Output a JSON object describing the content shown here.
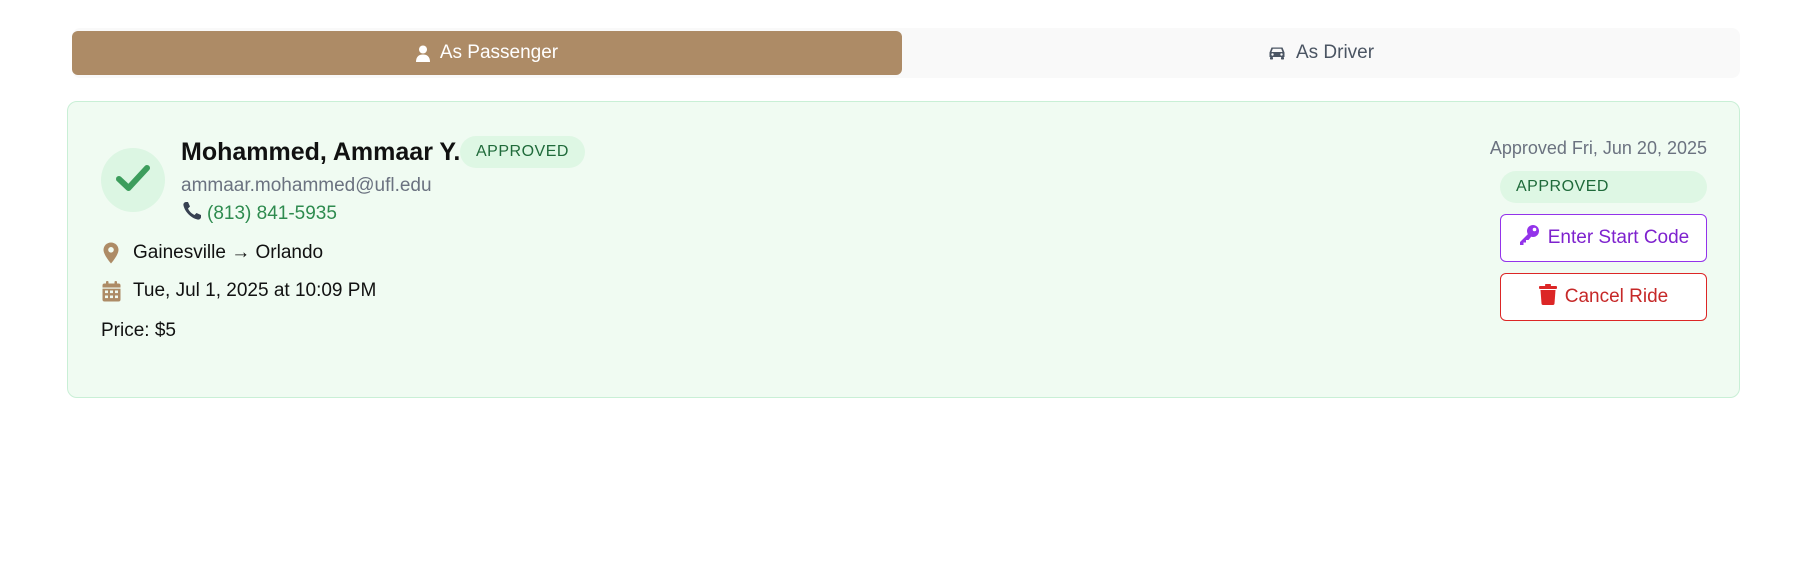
{
  "tabs": {
    "passenger_label": "As Passenger",
    "driver_label": "As Driver",
    "active": "passenger"
  },
  "ride": {
    "name": "Mohammed, Ammaar Y.",
    "status_badge": "APPROVED",
    "email": "ammaar.mohammed@ufl.edu",
    "phone": "(813) 841-5935",
    "route": "Gainesville → Orlando",
    "datetime": "Tue, Jul 1, 2025 at 10:09 PM",
    "price": "Price: $5",
    "approved_date": "Approved Fri, Jun 20, 2025",
    "status_badge_right": "APPROVED",
    "start_code_label": "Enter Start Code",
    "cancel_label": "Cancel Ride"
  },
  "icons": {
    "passenger": "user-icon",
    "driver": "car-icon",
    "status": "check-icon",
    "phone": "phone-icon",
    "route": "map-pin-icon",
    "date": "calendar-icon",
    "start_code": "key-icon",
    "cancel": "trash-icon"
  },
  "colors": {
    "brand": "#ad8b66",
    "approved_bg": "#f0fbf2",
    "approved_text": "#1f6a3a",
    "phone_link": "#2e8b4f",
    "start_code": "#9333ea",
    "cancel": "#dc2626"
  }
}
